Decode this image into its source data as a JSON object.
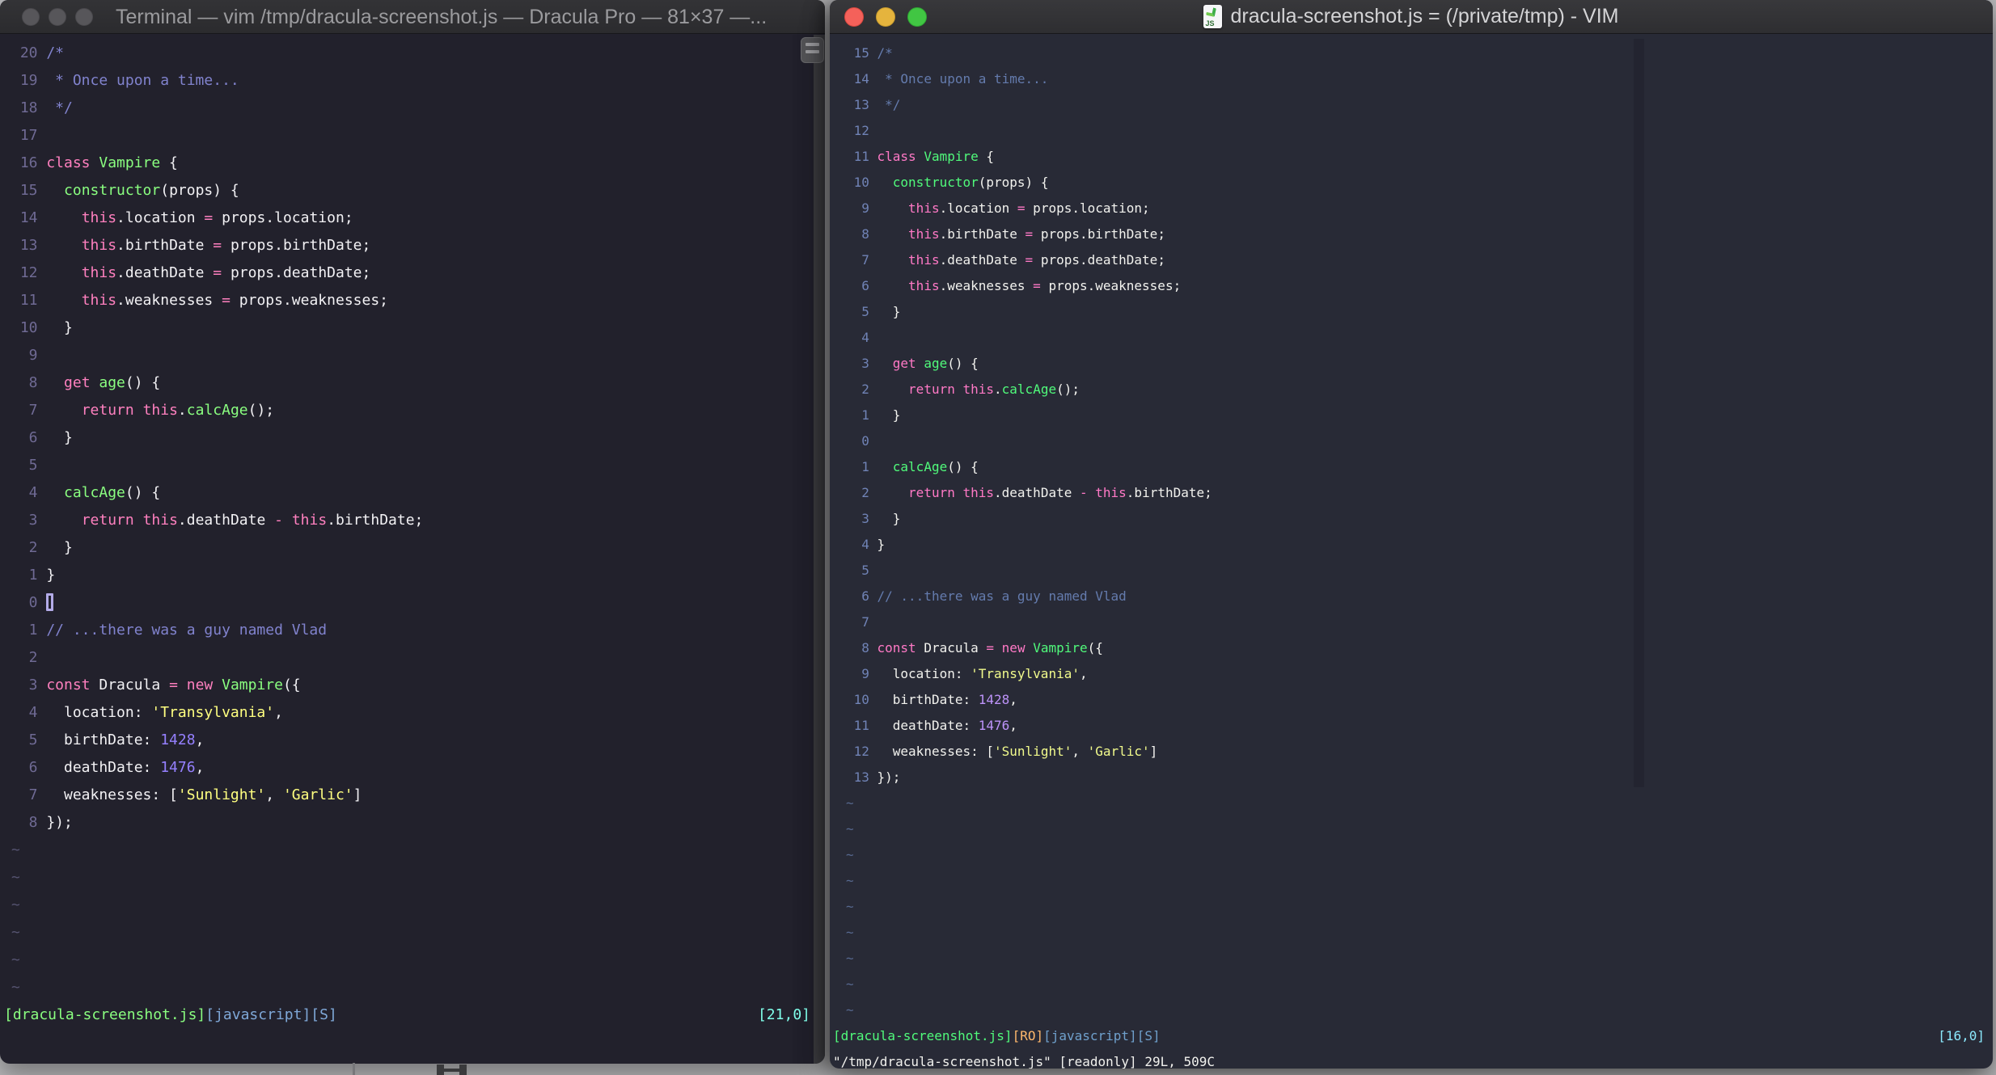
{
  "desktop": {
    "bg": "#B8B8BA"
  },
  "left_window": {
    "app": "Terminal",
    "title": "Terminal — vim /tmp/dracula-screenshot.js — Dracula Pro — 81×37 —...",
    "theme_name": "Dracula Pro",
    "palette": {
      "bg": "#22212C",
      "fg": "#F2F1F4",
      "gutter": "#6F6A94",
      "com": "#8183CE",
      "kw": "#FF80BF",
      "fn": "#8AFF80",
      "str": "#FFFF80",
      "num": "#9580FF",
      "tilde": "#555370",
      "cursor": "#B3ABE8",
      "sfile": "#8AFF80",
      "sro": "#FFCA80",
      "sinfo": "#7FA8D8",
      "spos": "#80FFEA"
    },
    "lines": [
      {
        "n": "20",
        "s": [
          [
            "com",
            "/*"
          ]
        ]
      },
      {
        "n": "19",
        "s": [
          [
            "com",
            " * Once upon a time..."
          ]
        ]
      },
      {
        "n": "18",
        "s": [
          [
            "com",
            " */"
          ]
        ]
      },
      {
        "n": "17",
        "s": []
      },
      {
        "n": "16",
        "s": [
          [
            "kw",
            "class "
          ],
          [
            "fn",
            "Vampire"
          ],
          [
            "fg",
            " {"
          ]
        ]
      },
      {
        "n": "15",
        "s": [
          [
            "fg",
            "  "
          ],
          [
            "fn",
            "constructor"
          ],
          [
            "fg",
            "(props) {"
          ]
        ]
      },
      {
        "n": "14",
        "s": [
          [
            "fg",
            "    "
          ],
          [
            "kw",
            "this"
          ],
          [
            "fg",
            ".location "
          ],
          [
            "kw",
            "="
          ],
          [
            "fg",
            " props.location;"
          ]
        ]
      },
      {
        "n": "13",
        "s": [
          [
            "fg",
            "    "
          ],
          [
            "kw",
            "this"
          ],
          [
            "fg",
            ".birthDate "
          ],
          [
            "kw",
            "="
          ],
          [
            "fg",
            " props.birthDate;"
          ]
        ]
      },
      {
        "n": "12",
        "s": [
          [
            "fg",
            "    "
          ],
          [
            "kw",
            "this"
          ],
          [
            "fg",
            ".deathDate "
          ],
          [
            "kw",
            "="
          ],
          [
            "fg",
            " props.deathDate;"
          ]
        ]
      },
      {
        "n": "11",
        "s": [
          [
            "fg",
            "    "
          ],
          [
            "kw",
            "this"
          ],
          [
            "fg",
            ".weaknesses "
          ],
          [
            "kw",
            "="
          ],
          [
            "fg",
            " props.weaknesses;"
          ]
        ]
      },
      {
        "n": "10",
        "s": [
          [
            "fg",
            "  }"
          ]
        ]
      },
      {
        "n": "9",
        "s": []
      },
      {
        "n": "8",
        "s": [
          [
            "fg",
            "  "
          ],
          [
            "kw",
            "get"
          ],
          [
            "fg",
            " "
          ],
          [
            "fn",
            "age"
          ],
          [
            "fg",
            "() {"
          ]
        ]
      },
      {
        "n": "7",
        "s": [
          [
            "fg",
            "    "
          ],
          [
            "kw",
            "return"
          ],
          [
            "fg",
            " "
          ],
          [
            "kw",
            "this"
          ],
          [
            "fg",
            "."
          ],
          [
            "fn",
            "calcAge"
          ],
          [
            "fg",
            "();"
          ]
        ]
      },
      {
        "n": "6",
        "s": [
          [
            "fg",
            "  }"
          ]
        ]
      },
      {
        "n": "5",
        "s": []
      },
      {
        "n": "4",
        "s": [
          [
            "fg",
            "  "
          ],
          [
            "fn",
            "calcAge"
          ],
          [
            "fg",
            "() {"
          ]
        ]
      },
      {
        "n": "3",
        "s": [
          [
            "fg",
            "    "
          ],
          [
            "kw",
            "return"
          ],
          [
            "fg",
            " "
          ],
          [
            "kw",
            "this"
          ],
          [
            "fg",
            ".deathDate "
          ],
          [
            "kw",
            "-"
          ],
          [
            "fg",
            " "
          ],
          [
            "kw",
            "this"
          ],
          [
            "fg",
            ".birthDate;"
          ]
        ]
      },
      {
        "n": "2",
        "s": [
          [
            "fg",
            "  }"
          ]
        ]
      },
      {
        "n": "1",
        "s": [
          [
            "fg",
            "}"
          ]
        ]
      },
      {
        "n": "0",
        "s": [],
        "cursor": "hollow"
      },
      {
        "n": "1",
        "s": [
          [
            "com",
            "// ...there was a guy named Vlad"
          ]
        ]
      },
      {
        "n": "2",
        "s": []
      },
      {
        "n": "3",
        "s": [
          [
            "kw",
            "const"
          ],
          [
            "fg",
            " Dracula "
          ],
          [
            "kw",
            "="
          ],
          [
            "fg",
            " "
          ],
          [
            "kw",
            "new"
          ],
          [
            "fg",
            " "
          ],
          [
            "fn",
            "Vampire"
          ],
          [
            "fg",
            "({"
          ]
        ]
      },
      {
        "n": "4",
        "s": [
          [
            "fg",
            "  location: "
          ],
          [
            "str",
            "'Transylvania'"
          ],
          [
            "fg",
            ","
          ]
        ]
      },
      {
        "n": "5",
        "s": [
          [
            "fg",
            "  birthDate: "
          ],
          [
            "num",
            "1428"
          ],
          [
            "fg",
            ","
          ]
        ]
      },
      {
        "n": "6",
        "s": [
          [
            "fg",
            "  deathDate: "
          ],
          [
            "num",
            "1476"
          ],
          [
            "fg",
            ","
          ]
        ]
      },
      {
        "n": "7",
        "s": [
          [
            "fg",
            "  weaknesses: ["
          ],
          [
            "str",
            "'Sunlight'"
          ],
          [
            "fg",
            ", "
          ],
          [
            "str",
            "'Garlic'"
          ],
          [
            "fg",
            "]"
          ]
        ]
      },
      {
        "n": "8",
        "s": [
          [
            "fg",
            "});"
          ]
        ]
      }
    ],
    "tildes": 6,
    "status": {
      "file": "[dracula-screenshot.js]",
      "info": "[javascript][S]",
      "pos": "[21,0]"
    }
  },
  "right_window": {
    "app": "VIM",
    "title": "dracula-screenshot.js = (/private/tmp) - VIM",
    "icon": "js-document-icon",
    "theme_name": "Dracula",
    "palette": {
      "bg": "#282A36",
      "fg": "#F2F2EE",
      "gutter": "#7083B6",
      "com": "#647BAD",
      "kw": "#FF79C6",
      "fn": "#50FA7B",
      "str": "#F1FA8C",
      "num": "#BD93F9",
      "tilde": "#56688F",
      "cursor": "#F2F2EE",
      "sfile": "#50FA7B",
      "sro": "#FFB86C",
      "sinfo": "#6FA0CC",
      "spos": "#8BE9FD"
    },
    "lines": [
      {
        "n": "15",
        "s": [
          [
            "com",
            "/*"
          ]
        ]
      },
      {
        "n": "14",
        "s": [
          [
            "com",
            " * Once upon a time..."
          ]
        ]
      },
      {
        "n": "13",
        "s": [
          [
            "com",
            " */"
          ]
        ]
      },
      {
        "n": "12",
        "s": []
      },
      {
        "n": "11",
        "s": [
          [
            "kw",
            "class "
          ],
          [
            "fn",
            "Vampire"
          ],
          [
            "fg",
            " {"
          ]
        ]
      },
      {
        "n": "10",
        "s": [
          [
            "fg",
            "  "
          ],
          [
            "fn",
            "constructor"
          ],
          [
            "fg",
            "(props) {"
          ]
        ]
      },
      {
        "n": "9",
        "s": [
          [
            "fg",
            "    "
          ],
          [
            "kw",
            "this"
          ],
          [
            "fg",
            ".location "
          ],
          [
            "kw",
            "="
          ],
          [
            "fg",
            " props.location;"
          ]
        ]
      },
      {
        "n": "8",
        "s": [
          [
            "fg",
            "    "
          ],
          [
            "kw",
            "this"
          ],
          [
            "fg",
            ".birthDate "
          ],
          [
            "kw",
            "="
          ],
          [
            "fg",
            " props.birthDate;"
          ]
        ]
      },
      {
        "n": "7",
        "s": [
          [
            "fg",
            "    "
          ],
          [
            "kw",
            "this"
          ],
          [
            "fg",
            ".deathDate "
          ],
          [
            "kw",
            "="
          ],
          [
            "fg",
            " props.deathDate;"
          ]
        ]
      },
      {
        "n": "6",
        "s": [
          [
            "fg",
            "    "
          ],
          [
            "kw",
            "this"
          ],
          [
            "fg",
            ".weaknesses "
          ],
          [
            "kw",
            "="
          ],
          [
            "fg",
            " props.weaknesses;"
          ]
        ]
      },
      {
        "n": "5",
        "s": [
          [
            "fg",
            "  }"
          ]
        ]
      },
      {
        "n": "4",
        "s": []
      },
      {
        "n": "3",
        "s": [
          [
            "fg",
            "  "
          ],
          [
            "kw",
            "get"
          ],
          [
            "fg",
            " "
          ],
          [
            "fn",
            "age"
          ],
          [
            "fg",
            "() {"
          ]
        ]
      },
      {
        "n": "2",
        "s": [
          [
            "fg",
            "    "
          ],
          [
            "kw",
            "return"
          ],
          [
            "fg",
            " "
          ],
          [
            "kw",
            "this"
          ],
          [
            "fg",
            "."
          ],
          [
            "fn",
            "calcAge"
          ],
          [
            "fg",
            "();"
          ]
        ]
      },
      {
        "n": "1",
        "s": [
          [
            "fg",
            "  }"
          ]
        ]
      },
      {
        "n": "0",
        "s": []
      },
      {
        "n": "1",
        "s": [
          [
            "fg",
            "  "
          ],
          [
            "fn",
            "calcAge"
          ],
          [
            "fg",
            "() {"
          ]
        ]
      },
      {
        "n": "2",
        "s": [
          [
            "fg",
            "    "
          ],
          [
            "kw",
            "return"
          ],
          [
            "fg",
            " "
          ],
          [
            "kw",
            "this"
          ],
          [
            "fg",
            ".deathDate "
          ],
          [
            "kw",
            "-"
          ],
          [
            "fg",
            " "
          ],
          [
            "kw",
            "this"
          ],
          [
            "fg",
            ".birthDate;"
          ]
        ]
      },
      {
        "n": "3",
        "s": [
          [
            "fg",
            "  }"
          ]
        ]
      },
      {
        "n": "4",
        "s": [
          [
            "fg",
            "}"
          ]
        ]
      },
      {
        "n": "5",
        "s": []
      },
      {
        "n": "6",
        "s": [
          [
            "com",
            "// ...there was a guy named Vlad"
          ]
        ]
      },
      {
        "n": "7",
        "s": []
      },
      {
        "n": "8",
        "s": [
          [
            "kw",
            "const"
          ],
          [
            "fg",
            " Dracula "
          ],
          [
            "kw",
            "="
          ],
          [
            "fg",
            " "
          ],
          [
            "kw",
            "new"
          ],
          [
            "fg",
            " "
          ],
          [
            "fn",
            "Vampire"
          ],
          [
            "fg",
            "({"
          ]
        ]
      },
      {
        "n": "9",
        "s": [
          [
            "fg",
            "  location: "
          ],
          [
            "str",
            "'Transylvania'"
          ],
          [
            "fg",
            ","
          ]
        ]
      },
      {
        "n": "10",
        "s": [
          [
            "fg",
            "  birthDate: "
          ],
          [
            "num",
            "1428"
          ],
          [
            "fg",
            ","
          ]
        ]
      },
      {
        "n": "11",
        "s": [
          [
            "fg",
            "  deathDate: "
          ],
          [
            "num",
            "1476"
          ],
          [
            "fg",
            ","
          ]
        ]
      },
      {
        "n": "12",
        "s": [
          [
            "fg",
            "  weaknesses: ["
          ],
          [
            "str",
            "'Sunlight'"
          ],
          [
            "fg",
            ", "
          ],
          [
            "str",
            "'Garlic'"
          ],
          [
            "fg",
            "]"
          ]
        ]
      },
      {
        "n": "13",
        "s": [
          [
            "fg",
            "});"
          ]
        ]
      }
    ],
    "tildes": 9,
    "status": {
      "file": "[dracula-screenshot.js]",
      "ro": "[RO]",
      "info": "[javascript][S]",
      "pos": "[16,0]"
    },
    "message": "\"/tmp/dracula-screenshot.js\" [readonly] 29L, 509C"
  }
}
